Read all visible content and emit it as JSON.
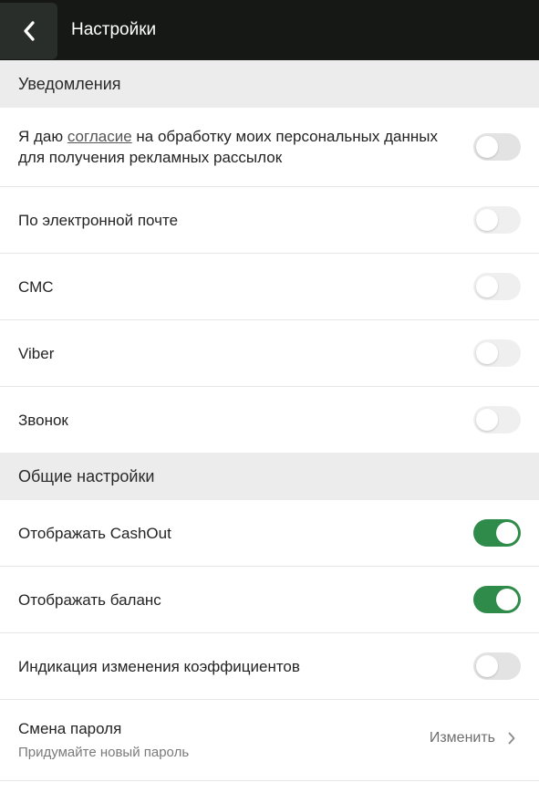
{
  "header": {
    "title": "Настройки"
  },
  "sections": {
    "notifications": "Уведомления",
    "general": "Общие настройки"
  },
  "consent": {
    "prefix": "Я даю ",
    "link": "согласие",
    "suffix": " на обработку моих персональных данных для получения рекламных рассылок",
    "enabled": false
  },
  "notification_items": [
    {
      "label": "По электронной почте",
      "enabled": false
    },
    {
      "label": "СМС",
      "enabled": false
    },
    {
      "label": "Viber",
      "enabled": false
    },
    {
      "label": "Звонок",
      "enabled": false
    }
  ],
  "general_items": [
    {
      "label": "Отображать CashOut",
      "enabled": true
    },
    {
      "label": "Отображать баланс",
      "enabled": true
    },
    {
      "label": "Индикация изменения коэффициентов",
      "enabled": false
    }
  ],
  "password": {
    "title": "Смена пароля",
    "subtitle": "Придумайте новый пароль",
    "action": "Изменить"
  },
  "colors": {
    "header_bg": "#151815",
    "toggle_on": "#2e8b4a",
    "section_bg": "#ececec"
  },
  "icons": {
    "back": "chevron-left-icon",
    "chevron": "chevron-right-icon"
  }
}
